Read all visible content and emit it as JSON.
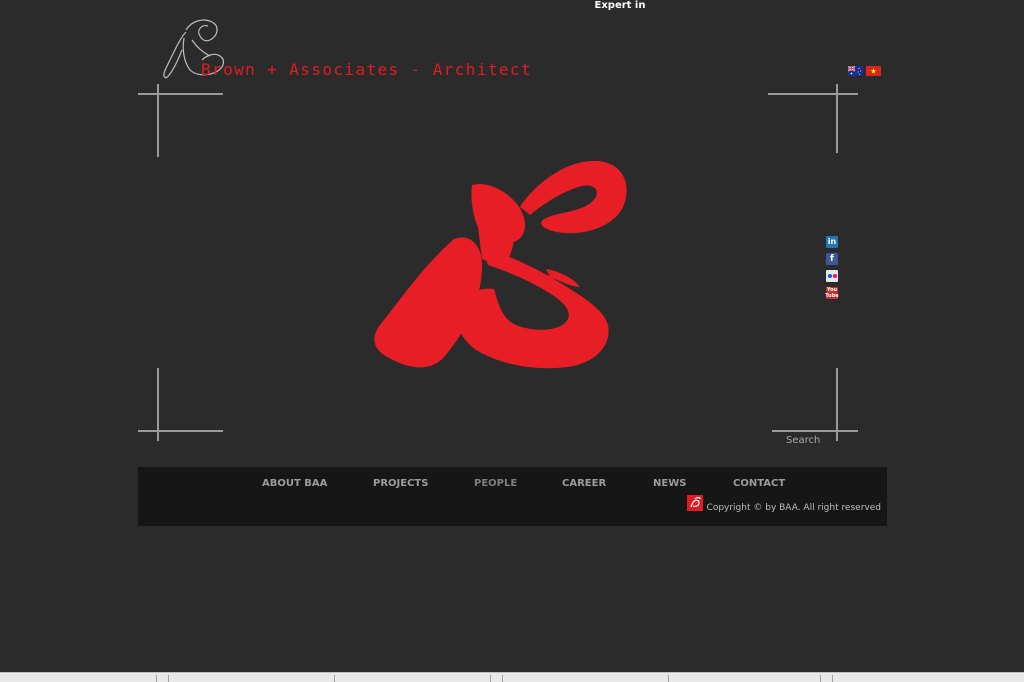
{
  "header": {
    "top_text": "Expert in",
    "site_name": "Brown + Associates - Architect"
  },
  "languages": [
    {
      "name": "australia-flag-icon"
    },
    {
      "name": "vietnam-flag-icon"
    }
  ],
  "social": {
    "linkedin": "in",
    "facebook": "f",
    "youtube_top": "You",
    "youtube_bottom": "Tube"
  },
  "search": {
    "label": "Search"
  },
  "nav": {
    "items": [
      "ABOUT BAA",
      "PROJECTS",
      "PEOPLE",
      "CAREER",
      "NEWS",
      "CONTACT"
    ]
  },
  "footer": {
    "copyright": "Copyright © by BAA. All right reserved"
  },
  "colors": {
    "background": "#2b2b2b",
    "brand_red": "#e11b22",
    "footer_bar": "#161616"
  }
}
